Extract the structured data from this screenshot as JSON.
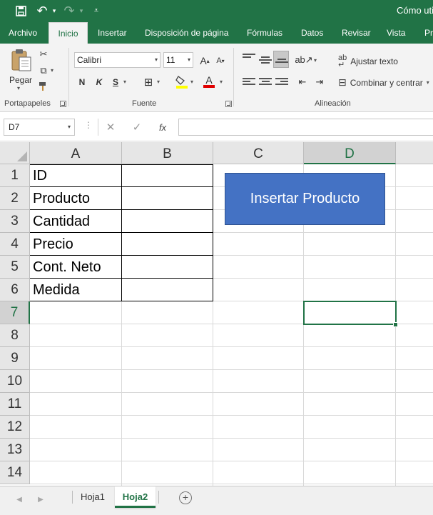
{
  "window": {
    "title_partial": "Cómo uti"
  },
  "ribbon_tabs": [
    "Archivo",
    "Inicio",
    "Insertar",
    "Disposición de página",
    "Fórmulas",
    "Datos",
    "Revisar",
    "Vista",
    "Pr"
  ],
  "active_tab": "Inicio",
  "clipboard": {
    "paste_label": "Pegar",
    "group_label": "Portapapeles"
  },
  "font": {
    "name": "Calibri",
    "size": "11",
    "bold": "N",
    "italic": "K",
    "underline": "S",
    "group_label": "Fuente",
    "grow_label": "A",
    "shrink_label": "A",
    "color_label": "A"
  },
  "alignment": {
    "wrap_label": "Ajustar texto",
    "merge_label": "Combinar y centrar",
    "group_label": "Alineación"
  },
  "formula_bar": {
    "name_box": "D7",
    "fx": "fx",
    "cancel": "✕",
    "enter": "✓",
    "value": ""
  },
  "columns": [
    "A",
    "B",
    "C",
    "D"
  ],
  "selected_column": "D",
  "rows": [
    "1",
    "2",
    "3",
    "4",
    "5",
    "6",
    "7",
    "8",
    "9",
    "10",
    "11",
    "12",
    "13",
    "14"
  ],
  "selected_row": "7",
  "cells": {
    "A1": "ID",
    "A2": "Producto",
    "A3": "Cantidad",
    "A4": "Precio",
    "A5": "Cont. Neto",
    "A6": "Medida"
  },
  "button": {
    "label": "Insertar Producto",
    "fill": "#4472c4"
  },
  "sheets": [
    "Hoja1",
    "Hoja2"
  ],
  "active_sheet": "Hoja2",
  "theme": {
    "accent": "#217346"
  }
}
